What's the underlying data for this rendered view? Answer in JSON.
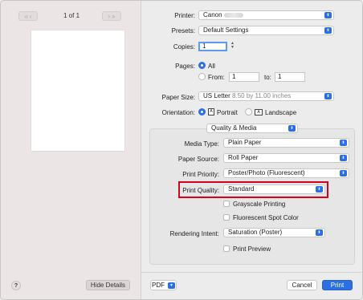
{
  "preview": {
    "page_count": "1 of 1",
    "first_icon": "«",
    "prev_icon": "‹",
    "next_icon": "›",
    "last_icon": "»",
    "help_label": "?",
    "hide_details_label": "Hide Details"
  },
  "form": {
    "printer_label": "Printer:",
    "printer_value": "Canon",
    "presets_label": "Presets:",
    "presets_value": "Default Settings",
    "copies_label": "Copies:",
    "copies_value": "1",
    "pages_label": "Pages:",
    "pages_all": "All",
    "pages_from": "From:",
    "pages_from_value": "1",
    "pages_to": "to:",
    "pages_to_value": "1",
    "paper_size_label": "Paper Size:",
    "paper_size_value": "US Letter",
    "paper_size_dims": "8.50 by 11.00 inches",
    "orientation_label": "Orientation:",
    "orientation_portrait": "Portrait",
    "orientation_landscape": "Landscape",
    "section_value": "Quality & Media",
    "media_type_label": "Media Type:",
    "media_type_value": "Plain Paper",
    "paper_source_label": "Paper Source:",
    "paper_source_value": "Roll Paper",
    "print_priority_label": "Print Priority:",
    "print_priority_value": "Poster/Photo (Fluorescent)",
    "print_quality_label": "Print Quality:",
    "print_quality_value": "Standard",
    "grayscale_label": "Grayscale Printing",
    "fluorescent_label": "Fluorescent Spot Color",
    "rendering_intent_label": "Rendering Intent:",
    "rendering_intent_value": "Saturation (Poster)",
    "print_preview_label": "Print Preview"
  },
  "footer": {
    "pdf_label": "PDF",
    "cancel_label": "Cancel",
    "print_label": "Print"
  },
  "icons": {
    "popup_arrow": "⬍",
    "stepper_up": "▲",
    "stepper_down": "▼",
    "portrait_glyph": "A",
    "landscape_glyph": "A",
    "pdf_arrow": "▼"
  },
  "colors": {
    "accent": "#2b6fe3",
    "highlight": "#d9001b"
  }
}
